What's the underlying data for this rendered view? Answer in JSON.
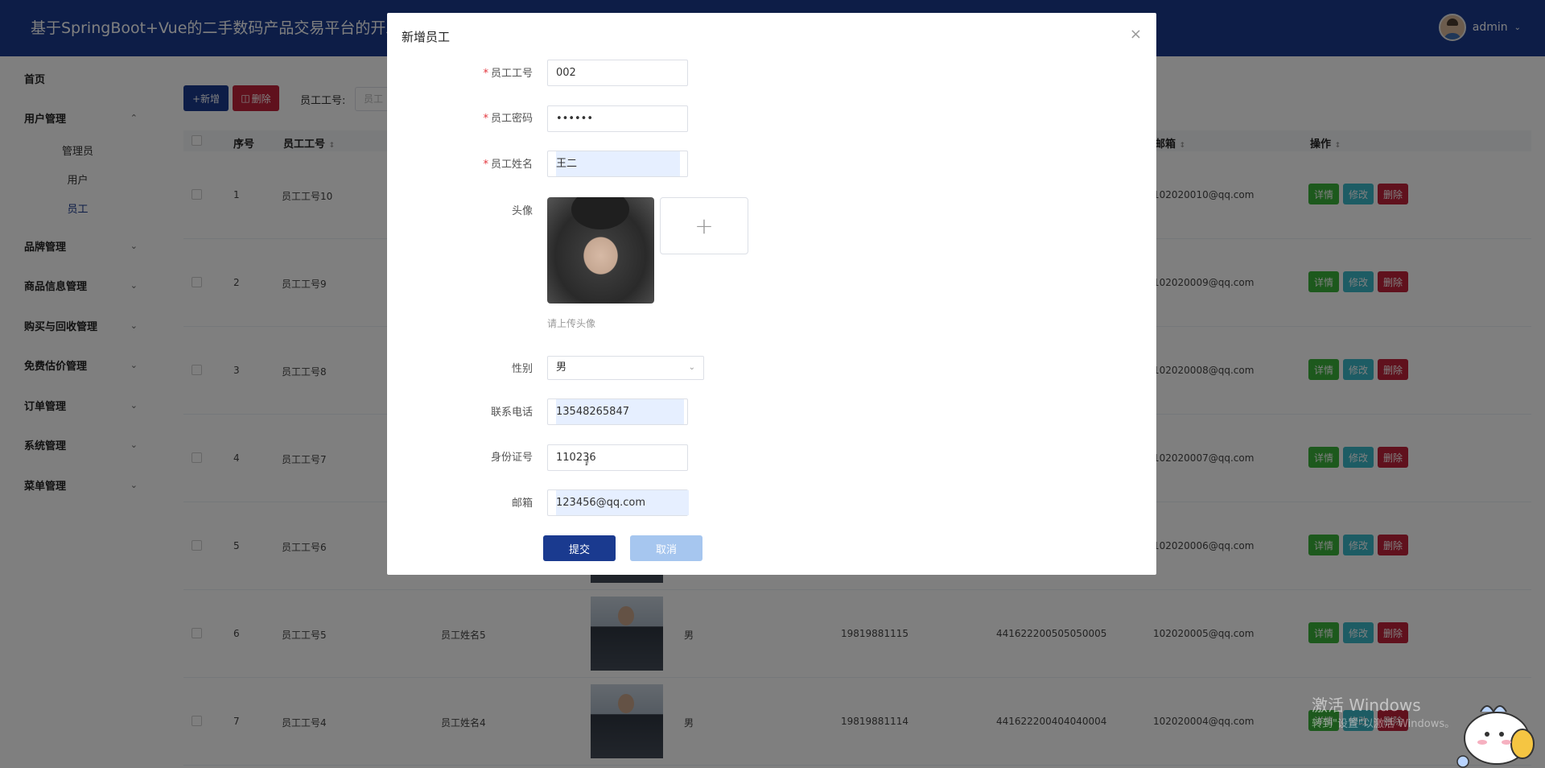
{
  "header": {
    "title": "基于SpringBoot+Vue的二手数码产品交易平台的开发",
    "username": "admin",
    "dropdown_icon": "chevron-down-icon"
  },
  "sidebar": {
    "home": "首页",
    "groups": [
      {
        "label": "用户管理",
        "expanded": true,
        "items": [
          "管理员",
          "用户",
          "员工"
        ],
        "active": "员工"
      },
      {
        "label": "品牌管理"
      },
      {
        "label": "商品信息管理"
      },
      {
        "label": "购买与回收管理"
      },
      {
        "label": "免费估价管理"
      },
      {
        "label": "订单管理"
      },
      {
        "label": "系统管理"
      },
      {
        "label": "菜单管理"
      }
    ]
  },
  "toolbar": {
    "add_label": "+新增",
    "delete_label": "删除",
    "filter_label": "员工工号:",
    "filter_placeholder": "员工"
  },
  "table": {
    "headers": {
      "index": "序号",
      "emp_no": "员工工号",
      "email": "邮箱",
      "ops": "操作"
    },
    "op_labels": {
      "detail": "详情",
      "edit": "修改",
      "remove": "删除"
    },
    "rows": [
      {
        "index": "1",
        "emp_no": "员工工号10",
        "name": "",
        "gender": "",
        "phone": "",
        "id_card": "",
        "email": "102020010@qq.com"
      },
      {
        "index": "2",
        "emp_no": "员工工号9",
        "name": "",
        "gender": "",
        "phone": "",
        "id_card": "",
        "email": "102020009@qq.com"
      },
      {
        "index": "3",
        "emp_no": "员工工号8",
        "name": "",
        "gender": "",
        "phone": "",
        "id_card": "",
        "email": "102020008@qq.com"
      },
      {
        "index": "4",
        "emp_no": "员工工号7",
        "name": "",
        "gender": "",
        "phone": "",
        "id_card": "",
        "email": "102020007@qq.com"
      },
      {
        "index": "5",
        "emp_no": "员工工号6",
        "name": "",
        "gender": "",
        "phone": "",
        "id_card": "",
        "email": "102020006@qq.com"
      },
      {
        "index": "6",
        "emp_no": "员工工号5",
        "name": "员工姓名5",
        "gender": "男",
        "phone": "19819881115",
        "id_card": "441622200505050005",
        "email": "102020005@qq.com"
      },
      {
        "index": "7",
        "emp_no": "员工工号4",
        "name": "员工姓名4",
        "gender": "男",
        "phone": "19819881114",
        "id_card": "441622200404040004",
        "email": "102020004@qq.com"
      }
    ]
  },
  "dialog": {
    "title": "新增员工",
    "fields": {
      "emp_no": {
        "label": "员工工号",
        "value": "002"
      },
      "password": {
        "label": "员工密码",
        "value": "••••••"
      },
      "name": {
        "label": "员工姓名",
        "value": "王二"
      },
      "avatar": {
        "label": "头像",
        "hint": "请上传头像"
      },
      "gender": {
        "label": "性别",
        "value": "男"
      },
      "phone": {
        "label": "联系电话",
        "value": "13548265847"
      },
      "id_card": {
        "label": "身份证号",
        "value": "110236"
      },
      "email": {
        "label": "邮箱",
        "value": "123456@qq.com"
      }
    },
    "submit_label": "提交",
    "cancel_label": "取消"
  },
  "watermark": {
    "line1": "激活 Windows",
    "line2": "转到\"设置\"以激活 Windows。"
  }
}
